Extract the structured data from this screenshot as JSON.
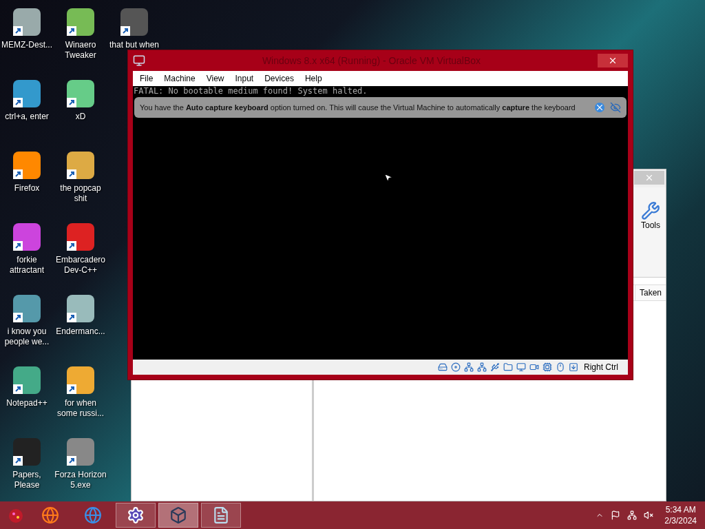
{
  "desktop_icons": [
    {
      "label": "MEMZ-Dest..."
    },
    {
      "label": "ctrl+a, enter"
    },
    {
      "label": "Firefox"
    },
    {
      "label": "forkie attractant"
    },
    {
      "label": "i know you people we..."
    },
    {
      "label": "Notepad++"
    },
    {
      "label": "Papers, Please"
    },
    {
      "label": "Winaero Tweaker"
    },
    {
      "label": "xD"
    },
    {
      "label": "the popcap shit"
    },
    {
      "label": "Embarcadero Dev-C++"
    },
    {
      "label": "Endermanc..."
    },
    {
      "label": "for when some russi..."
    },
    {
      "label": "Forza Horizon 5.exe"
    },
    {
      "label": "that but when"
    }
  ],
  "background_window": {
    "toolbar": [
      {
        "label": "Tools"
      }
    ],
    "table": {
      "columns": [
        "Taken"
      ]
    }
  },
  "vm_window": {
    "title": "Windows 8.x x64 (Running) - Oracle VM VirtualBox",
    "menu": [
      "File",
      "Machine",
      "View",
      "Input",
      "Devices",
      "Help"
    ],
    "console_text": "FATAL: No bootable medium found! System halted.",
    "notification": "You have the **Auto capture keyboard** option turned on. This will cause the Virtual Machine to automatically **capture** the keyboard",
    "status_bar": {
      "host_key": "Right Ctrl"
    }
  },
  "taskbar": {
    "apps": [
      {
        "running": false,
        "selected": false
      },
      {
        "running": false,
        "selected": false
      },
      {
        "running": true,
        "selected": false
      },
      {
        "running": true,
        "selected": true
      },
      {
        "running": true,
        "selected": false
      }
    ],
    "time": "5:34 AM",
    "date": "2/3/2024"
  }
}
